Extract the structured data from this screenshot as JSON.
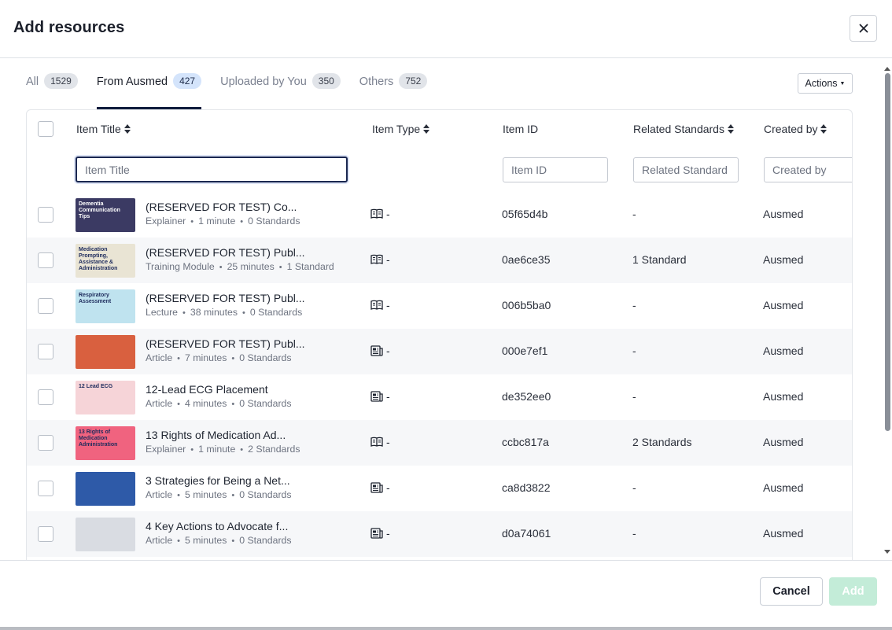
{
  "modal": {
    "title": "Add resources",
    "close_icon": "close-icon"
  },
  "tabs": [
    {
      "label": "All",
      "count": "1529",
      "active": false
    },
    {
      "label": "From Ausmed",
      "count": "427",
      "active": true
    },
    {
      "label": "Uploaded by You",
      "count": "350",
      "active": false
    },
    {
      "label": "Others",
      "count": "752",
      "active": false
    }
  ],
  "actions": {
    "label": "Actions"
  },
  "columns": {
    "title": "Item Title",
    "type": "Item Type",
    "id": "Item ID",
    "standards": "Related Standards",
    "created_by": "Created by"
  },
  "filters": {
    "title_placeholder": "Item Title",
    "id_placeholder": "Item ID",
    "standards_placeholder": "Related Standard",
    "created_by_placeholder": "Created by"
  },
  "rows": [
    {
      "title": "(RESERVED FOR TEST) Co...",
      "kind": "Explainer",
      "duration": "1 minute",
      "standards_count": "0 Standards",
      "type_icon": "book-icon",
      "type_text": "-",
      "id": "05f65d4b",
      "standards": "-",
      "created_by": "Ausmed",
      "thumb_text": "Dementia Communication Tips",
      "thumb_color": "#3b3a63"
    },
    {
      "title": "(RESERVED FOR TEST) Publ...",
      "kind": "Training Module",
      "duration": "25 minutes",
      "standards_count": "1 Standard",
      "type_icon": "book-icon",
      "type_text": "-",
      "id": "0ae6ce35",
      "standards": "1 Standard",
      "created_by": "Ausmed",
      "thumb_text": "Medication Prompting, Assistance & Administration",
      "thumb_color": "#e9e4d4"
    },
    {
      "title": "(RESERVED FOR TEST) Publ...",
      "kind": "Lecture",
      "duration": "38 minutes",
      "standards_count": "0 Standards",
      "type_icon": "book-icon",
      "type_text": "-",
      "id": "006b5ba0",
      "standards": "-",
      "created_by": "Ausmed",
      "thumb_text": "Respiratory Assessment",
      "thumb_color": "#bfe3ef"
    },
    {
      "title": "(RESERVED FOR TEST) Publ...",
      "kind": "Article",
      "duration": "7 minutes",
      "standards_count": "0 Standards",
      "type_icon": "article-icon",
      "type_text": "-",
      "id": "000e7ef1",
      "standards": "-",
      "created_by": "Ausmed",
      "thumb_text": "",
      "thumb_color": "#d9603f"
    },
    {
      "title": "12-Lead ECG Placement",
      "kind": "Article",
      "duration": "4 minutes",
      "standards_count": "0 Standards",
      "type_icon": "article-icon",
      "type_text": "-",
      "id": "de352ee0",
      "standards": "-",
      "created_by": "Ausmed",
      "thumb_text": "12 Lead ECG",
      "thumb_color": "#f6d4d8"
    },
    {
      "title": "13 Rights of Medication Ad...",
      "kind": "Explainer",
      "duration": "1 minute",
      "standards_count": "2 Standards",
      "type_icon": "book-icon",
      "type_text": "-",
      "id": "ccbc817a",
      "standards": "2 Standards",
      "created_by": "Ausmed",
      "thumb_text": "13 Rights of Medication Administration",
      "thumb_color": "#f0637f"
    },
    {
      "title": "3 Strategies for Being a Net...",
      "kind": "Article",
      "duration": "5 minutes",
      "standards_count": "0 Standards",
      "type_icon": "article-icon",
      "type_text": "-",
      "id": "ca8d3822",
      "standards": "-",
      "created_by": "Ausmed",
      "thumb_text": "",
      "thumb_color": "#2e5aa8"
    },
    {
      "title": "4 Key Actions to Advocate f...",
      "kind": "Article",
      "duration": "5 minutes",
      "standards_count": "0 Standards",
      "type_icon": "article-icon",
      "type_text": "-",
      "id": "d0a74061",
      "standards": "-",
      "created_by": "Ausmed",
      "thumb_text": "",
      "thumb_color": "#d9dce2"
    }
  ],
  "footer": {
    "cancel_label": "Cancel",
    "add_label": "Add"
  },
  "colors": {
    "active_tab_underline": "#0f1c3d",
    "add_button_disabled": "#c3ecd8"
  }
}
